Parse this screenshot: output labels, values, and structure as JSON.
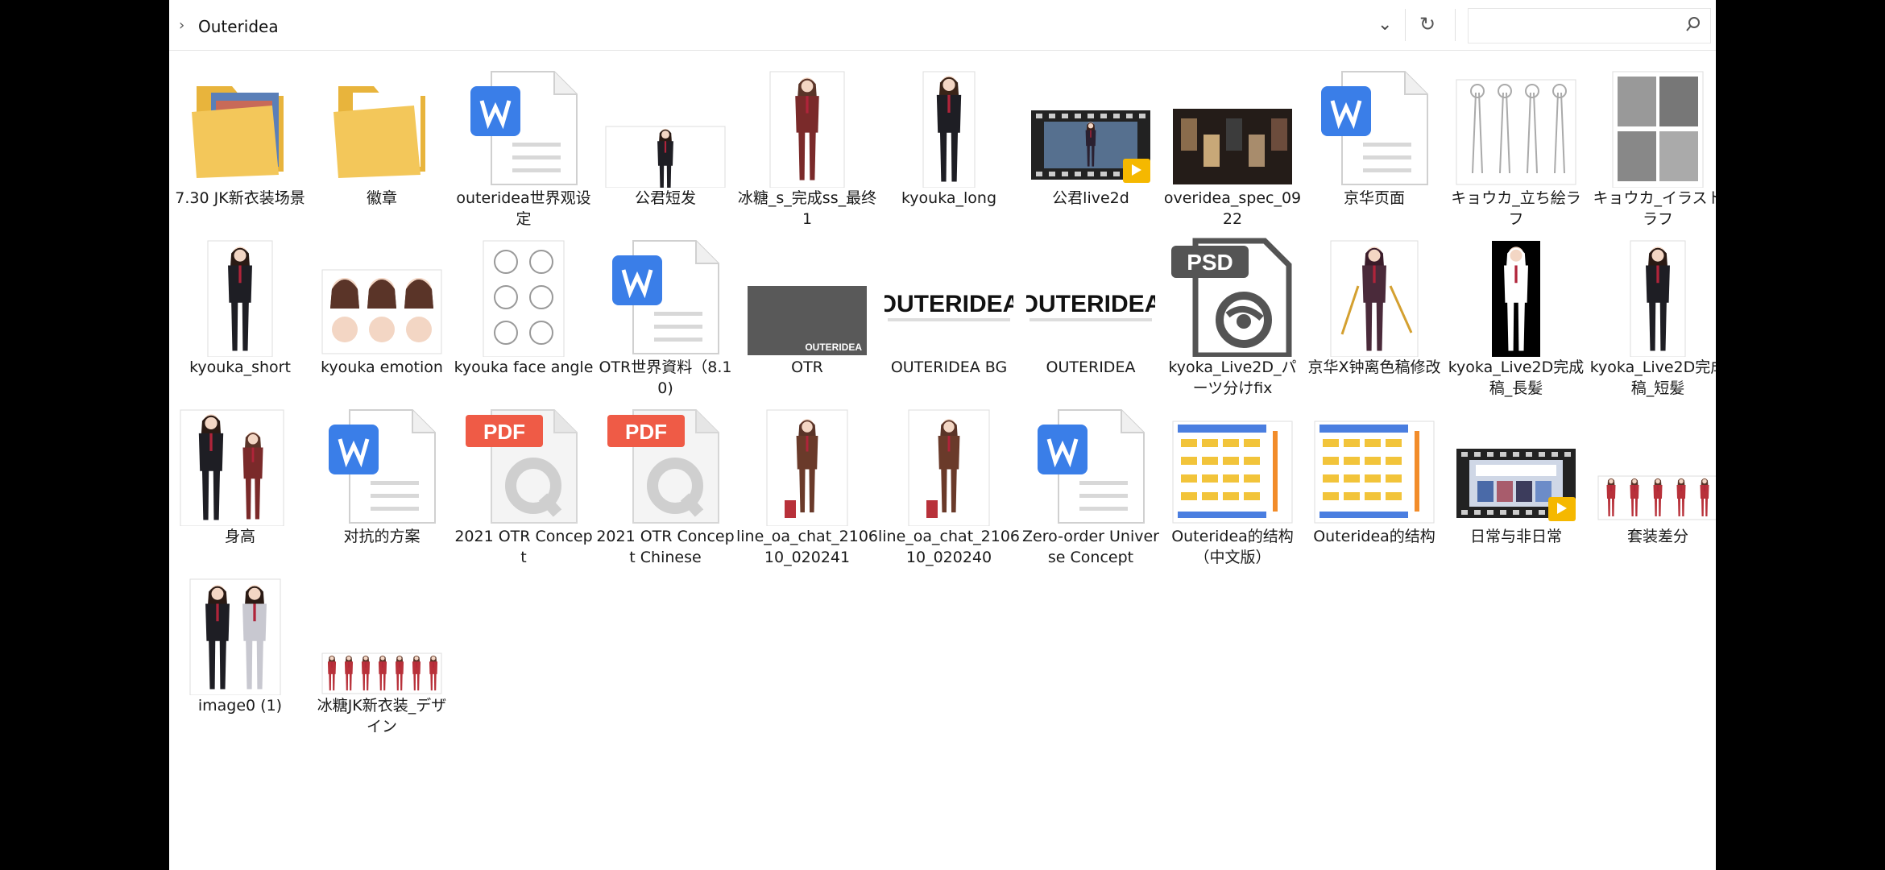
{
  "address_bar": {
    "path": "Outeridea",
    "search_placeholder": ""
  },
  "files": [
    {
      "name": "7.30 JK新衣装场景",
      "icon": "folder-icon"
    },
    {
      "name": "徽章",
      "icon": "folder-icon"
    },
    {
      "name": "outeridea世界观设定",
      "icon": "word-doc-icon"
    },
    {
      "name": "公君短发",
      "icon": "image-thumbnail"
    },
    {
      "name": "冰糖_s_完成ss_最终1",
      "icon": "image-thumbnail"
    },
    {
      "name": "kyouka_long",
      "icon": "image-thumbnail"
    },
    {
      "name": "公君live2d",
      "icon": "video-thumbnail"
    },
    {
      "name": "overidea_spec_0922",
      "icon": "image-thumbnail"
    },
    {
      "name": "京华页面",
      "icon": "word-doc-icon"
    },
    {
      "name": "キョウカ_立ち絵ラフ",
      "icon": "image-thumbnail"
    },
    {
      "name": "キョウカ_イラストラフ",
      "icon": "image-thumbnail"
    },
    {
      "name": "kyouka_short",
      "icon": "image-thumbnail"
    },
    {
      "name": "kyouka emotion",
      "icon": "image-thumbnail"
    },
    {
      "name": "kyouka face angle",
      "icon": "image-thumbnail"
    },
    {
      "name": "OTR世界資料（8.10)",
      "icon": "word-doc-icon"
    },
    {
      "name": "OTR",
      "icon": "image-thumbnail",
      "thumb_text": "OUTERIDEA"
    },
    {
      "name": "OUTERIDEA BG",
      "icon": "logo-thumbnail",
      "thumb_text": "OUTERIDEA"
    },
    {
      "name": "OUTERIDEA",
      "icon": "logo-thumbnail",
      "thumb_text": "OUTERIDEA"
    },
    {
      "name": "kyoka_Live2D_パーツ分けfix",
      "icon": "psd-icon",
      "badge": "PSD"
    },
    {
      "name": "京华X钟离色稿修改",
      "icon": "image-thumbnail"
    },
    {
      "name": "kyoka_Live2D完成稿_長髪",
      "icon": "image-thumbnail"
    },
    {
      "name": "kyoka_Live2D完成稿_短髪",
      "icon": "image-thumbnail"
    },
    {
      "name": "身高",
      "icon": "image-thumbnail"
    },
    {
      "name": "对抗的方案",
      "icon": "word-doc-icon"
    },
    {
      "name": "2021 OTR Concept",
      "icon": "pdf-icon",
      "badge": "PDF"
    },
    {
      "name": "2021 OTR Concept Chinese",
      "icon": "pdf-icon",
      "badge": "PDF"
    },
    {
      "name": "line_oa_chat_210610_020241",
      "icon": "image-thumbnail"
    },
    {
      "name": "line_oa_chat_210610_020240",
      "icon": "image-thumbnail"
    },
    {
      "name": "Zero-order Universe Concept",
      "icon": "word-doc-icon"
    },
    {
      "name": "Outeridea的结构（中文版）",
      "icon": "image-thumbnail"
    },
    {
      "name": "Outeridea的结构",
      "icon": "image-thumbnail"
    },
    {
      "name": "日常与非日常",
      "icon": "video-thumbnail"
    },
    {
      "name": "套装差分",
      "icon": "image-thumbnail"
    },
    {
      "name": "image0 (1)",
      "icon": "image-thumbnail"
    },
    {
      "name": "冰糖JK新衣装_デザイン",
      "icon": "image-thumbnail"
    }
  ],
  "colors": {
    "word_blue": "#3a7ee8",
    "pdf_red": "#ef5b46",
    "folder_yellow": "#f3c75a",
    "player_badge": "#f5b800",
    "psd_gray": "#545454"
  }
}
